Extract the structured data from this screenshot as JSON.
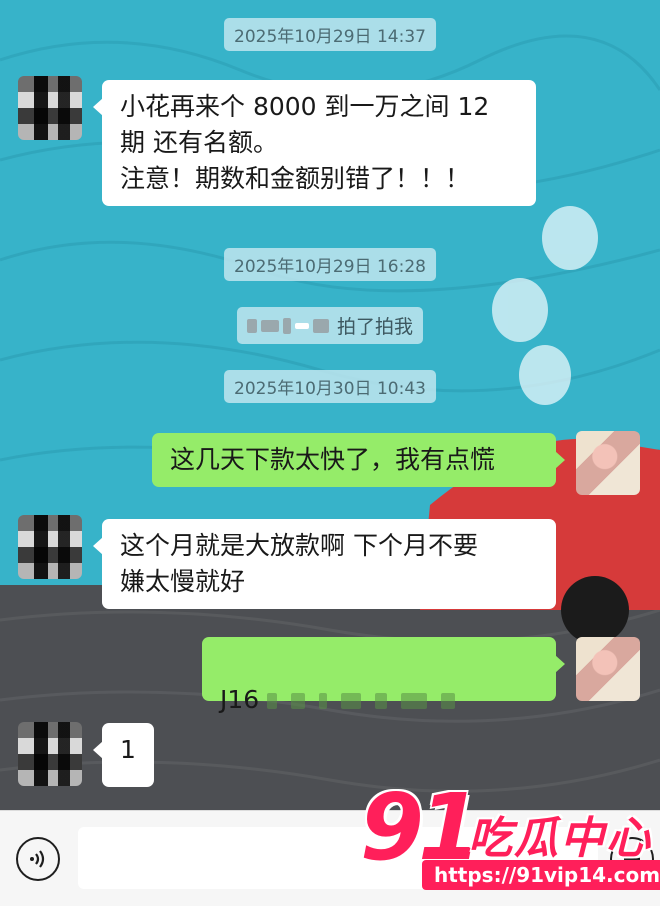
{
  "timestamps": {
    "t1": "2025年10月29日 14:37",
    "t2": "2025年10月29日 16:28",
    "t3": "2025年10月30日 10:43"
  },
  "system": {
    "pat_text": "拍了拍我"
  },
  "messages": {
    "m1": "小花再来个 8000 到一万之间 12\n期 还有名额。\n注意！期数和金额别错了！！！",
    "m2": "这几天下款太快了，我有点慌",
    "m3": "这个月就是大放款啊 下个月不要\n嫌太慢就好",
    "m4_prefix": "J16",
    "m5": "1"
  },
  "icons": {
    "voice": "voice-icon",
    "plus": "plus-icon"
  },
  "watermark": {
    "number": "91",
    "name": "吃瓜中心",
    "url": "https://91vip14.com"
  },
  "colors": {
    "chat_bg": "#37b3c9",
    "bubble_out": "#95ec69",
    "bubble_in": "#ffffff",
    "watermark": "#ff1f5a"
  }
}
